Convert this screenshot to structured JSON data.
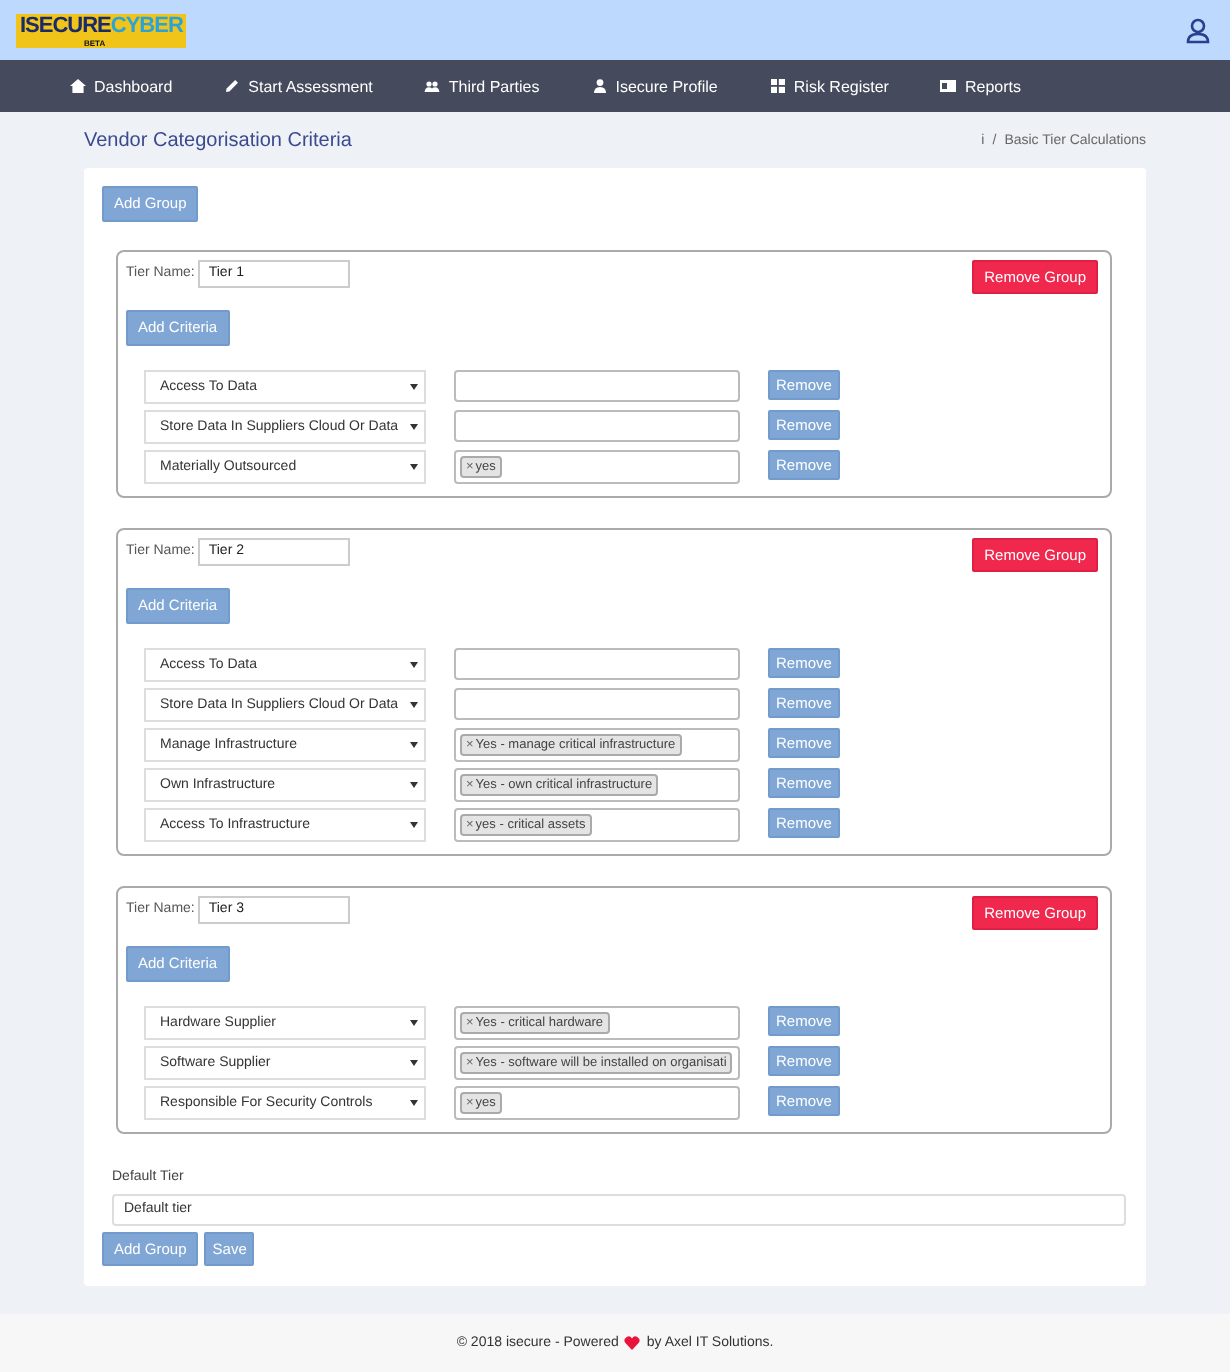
{
  "logo": {
    "part_1": "ISECURE",
    "part_2": "CYBER",
    "sub": "BETA"
  },
  "nav": [
    {
      "kind": "home",
      "label": "Dashboard"
    },
    {
      "kind": "pencil",
      "label": "Start Assessment"
    },
    {
      "kind": "people",
      "label": "Third Parties"
    },
    {
      "kind": "person",
      "label": "Isecure Profile"
    },
    {
      "kind": "grid",
      "label": "Risk Register"
    },
    {
      "kind": "card",
      "label": "Reports"
    }
  ],
  "page_title": "Vendor Categorisation Criteria",
  "breadcrumb": {
    "items": [
      "i",
      "Basic Tier Calculations"
    ],
    "separator": "/"
  },
  "add_group_top": "Add Group",
  "groups": [
    {
      "tier_label": "Tier Name:",
      "tier_value": "Tier 1",
      "remove_group": "Remove Group",
      "add_criteria": "Add Criteria",
      "criteria": [
        {
          "select": "Access To Data",
          "remove": "Remove"
        },
        {
          "select": "Store Data In Suppliers Cloud Or Data",
          "remove": "Remove"
        },
        {
          "select": "Materially Outsourced",
          "tags": [
            {
              "x": "×",
              "label": "yes"
            }
          ],
          "remove": "Remove"
        }
      ]
    },
    {
      "tier_label": "Tier Name:",
      "tier_value": "Tier 2",
      "remove_group": "Remove Group",
      "add_criteria": "Add Criteria",
      "criteria": [
        {
          "select": "Access To Data",
          "remove": "Remove"
        },
        {
          "select": "Store Data In Suppliers Cloud Or Data",
          "remove": "Remove"
        },
        {
          "select": "Manage Infrastructure",
          "tags": [
            {
              "x": "×",
              "label": "Yes - manage critical infrastructure"
            }
          ],
          "remove": "Remove"
        },
        {
          "select": "Own Infrastructure",
          "tags": [
            {
              "x": "×",
              "label": "Yes - own critical infrastructure"
            }
          ],
          "remove": "Remove"
        },
        {
          "select": "Access To Infrastructure",
          "tags": [
            {
              "x": "×",
              "label": "yes - critical assets"
            }
          ],
          "remove": "Remove"
        }
      ]
    },
    {
      "tier_label": "Tier Name:",
      "tier_value": "Tier 3",
      "remove_group": "Remove Group",
      "add_criteria": "Add Criteria",
      "criteria": [
        {
          "select": "Hardware Supplier",
          "tags": [
            {
              "x": "×",
              "label": "Yes - critical hardware"
            }
          ],
          "remove": "Remove"
        },
        {
          "select": "Software Supplier",
          "tags": [
            {
              "x": "×",
              "label": "Yes - software will be installed on organisati"
            }
          ],
          "remove": "Remove"
        },
        {
          "select": "Responsible For Security Controls",
          "tags": [
            {
              "x": "×",
              "label": "yes"
            }
          ],
          "remove": "Remove"
        }
      ]
    }
  ],
  "default_tier": {
    "label": "Default Tier",
    "value": "Default tier"
  },
  "bottom_buttons": [
    "Add Group",
    "Save"
  ],
  "footer": {
    "before": "© 2018 isecure - Powered",
    "after": "by Axel IT Solutions."
  }
}
